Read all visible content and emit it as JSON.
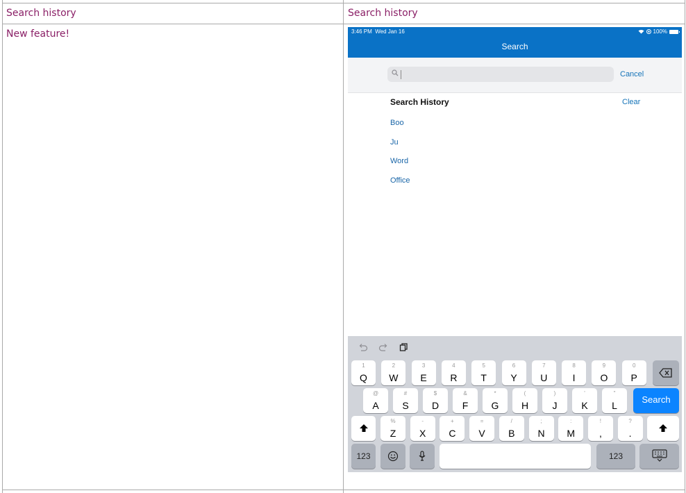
{
  "doc": {
    "header_left": "Search history",
    "header_right": "Search history",
    "note": "New feature!"
  },
  "ipad": {
    "status_time": "3:46 PM",
    "status_date": "Wed Jan 16",
    "battery": "100%",
    "nav_title": "Search",
    "search_value": "",
    "cancel_label": "Cancel",
    "history_title": "Search History",
    "clear_label": "Clear",
    "history_items": [
      "Boo",
      "Ju",
      "Word",
      "Office"
    ]
  },
  "keyboard": {
    "row1": [
      {
        "main": "Q",
        "sec": "1"
      },
      {
        "main": "W",
        "sec": "2"
      },
      {
        "main": "E",
        "sec": "3"
      },
      {
        "main": "R",
        "sec": "4"
      },
      {
        "main": "T",
        "sec": "5"
      },
      {
        "main": "Y",
        "sec": "6"
      },
      {
        "main": "U",
        "sec": "7"
      },
      {
        "main": "I",
        "sec": "8"
      },
      {
        "main": "O",
        "sec": "9"
      },
      {
        "main": "P",
        "sec": "0"
      }
    ],
    "row2": [
      {
        "main": "A",
        "sec": "@"
      },
      {
        "main": "S",
        "sec": "#"
      },
      {
        "main": "D",
        "sec": "$"
      },
      {
        "main": "F",
        "sec": "&"
      },
      {
        "main": "G",
        "sec": "*"
      },
      {
        "main": "H",
        "sec": "("
      },
      {
        "main": "J",
        "sec": ")"
      },
      {
        "main": "K",
        "sec": "'"
      },
      {
        "main": "L",
        "sec": "\""
      }
    ],
    "row3": [
      {
        "main": "Z",
        "sec": "%"
      },
      {
        "main": "X",
        "sec": "-"
      },
      {
        "main": "C",
        "sec": "+"
      },
      {
        "main": "V",
        "sec": "="
      },
      {
        "main": "B",
        "sec": "/"
      },
      {
        "main": "N",
        "sec": ";"
      },
      {
        "main": "M",
        "sec": ":"
      },
      {
        "main": ",",
        "sec": "!"
      },
      {
        "main": ".",
        "sec": "?"
      }
    ],
    "search_key": "Search",
    "numbers_key_left": "123",
    "numbers_key_right": "123",
    "space_label": ""
  },
  "colors": {
    "doc_text": "#8a1f66",
    "nav_bar": "#0a72c6",
    "link": "#1473b8",
    "keyboard_bg": "#d1d4da",
    "search_key": "#0b84ff"
  }
}
